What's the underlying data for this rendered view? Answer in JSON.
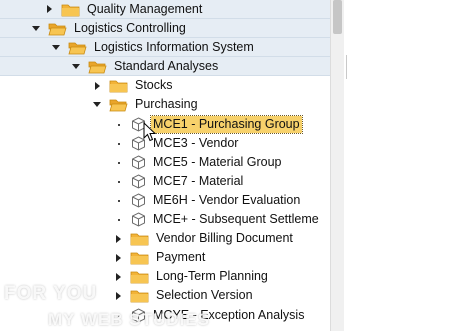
{
  "tree": {
    "items": [
      {
        "label": "Quality Management",
        "kind": "folder",
        "expanded": false
      },
      {
        "label": "Logistics Controlling",
        "kind": "folder",
        "expanded": true
      },
      {
        "label": "Logistics Information System",
        "kind": "folder",
        "expanded": true
      },
      {
        "label": "Standard Analyses",
        "kind": "folder",
        "expanded": true
      },
      {
        "label": "Stocks",
        "kind": "folder",
        "expanded": false
      },
      {
        "label": "Purchasing",
        "kind": "folder",
        "expanded": true
      },
      {
        "label": "MCE1 - Purchasing Group",
        "kind": "transaction",
        "selected": true
      },
      {
        "label": "MCE3 - Vendor",
        "kind": "transaction"
      },
      {
        "label": "MCE5 - Material Group",
        "kind": "transaction"
      },
      {
        "label": "MCE7 - Material",
        "kind": "transaction"
      },
      {
        "label": "ME6H - Vendor Evaluation",
        "kind": "transaction"
      },
      {
        "label": "MCE+ - Subsequent Settleme",
        "kind": "transaction"
      },
      {
        "label": "Vendor Billing Document",
        "kind": "folder",
        "expanded": false
      },
      {
        "label": "Payment",
        "kind": "folder",
        "expanded": false
      },
      {
        "label": "Long-Term Planning",
        "kind": "folder",
        "expanded": false
      },
      {
        "label": "Selection Version",
        "kind": "folder",
        "expanded": false
      },
      {
        "label": "MCYE - Exception Analysis",
        "kind": "transaction"
      }
    ]
  },
  "watermark": {
    "line1": "FOR YOU",
    "line2": "MY WEB STUDIES"
  },
  "colors": {
    "band": "#e6edf4",
    "selection": "#f7d16b",
    "folder": "#f2b338"
  }
}
